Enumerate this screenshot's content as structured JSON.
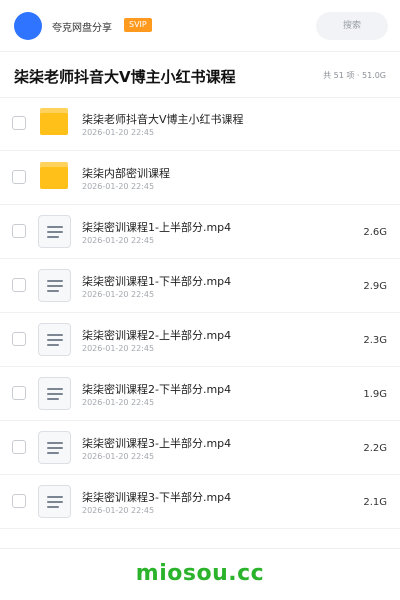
{
  "header": {
    "sharer": "夸克网盘分享",
    "badge": "SVIP",
    "search_label": "搜索"
  },
  "title_bar": {
    "title": "柒柒老师抖音大V博主小红书课程",
    "summary": "共 51 项 · 51.0G"
  },
  "files": [
    {
      "type": "folder",
      "name": "柒柒老师抖音大V博主小红书课程",
      "date": "2026-01-20 22:45",
      "size": ""
    },
    {
      "type": "folder",
      "name": "柒柒内部密训课程",
      "date": "2026-01-20 22:45",
      "size": ""
    },
    {
      "type": "file",
      "name": "柒柒密训课程1-上半部分.mp4",
      "date": "2026-01-20 22:45",
      "size": "2.6G"
    },
    {
      "type": "file",
      "name": "柒柒密训课程1-下半部分.mp4",
      "date": "2026-01-20 22:45",
      "size": "2.9G"
    },
    {
      "type": "file",
      "name": "柒柒密训课程2-上半部分.mp4",
      "date": "2026-01-20 22:45",
      "size": "2.3G"
    },
    {
      "type": "file",
      "name": "柒柒密训课程2-下半部分.mp4",
      "date": "2026-01-20 22:45",
      "size": "1.9G"
    },
    {
      "type": "file",
      "name": "柒柒密训课程3-上半部分.mp4",
      "date": "2026-01-20 22:45",
      "size": "2.2G"
    },
    {
      "type": "file",
      "name": "柒柒密训课程3-下半部分.mp4",
      "date": "2026-01-20 22:45",
      "size": "2.1G"
    }
  ],
  "footer": {
    "watermark": "miosou.cc"
  },
  "colors": {
    "avatar": "#2f74ff",
    "badge": "#ff9a1f",
    "folder": "#ffc01a",
    "watermark": "#2bb32b"
  },
  "icons": {
    "folder": "folder-icon",
    "file": "document-icon"
  }
}
